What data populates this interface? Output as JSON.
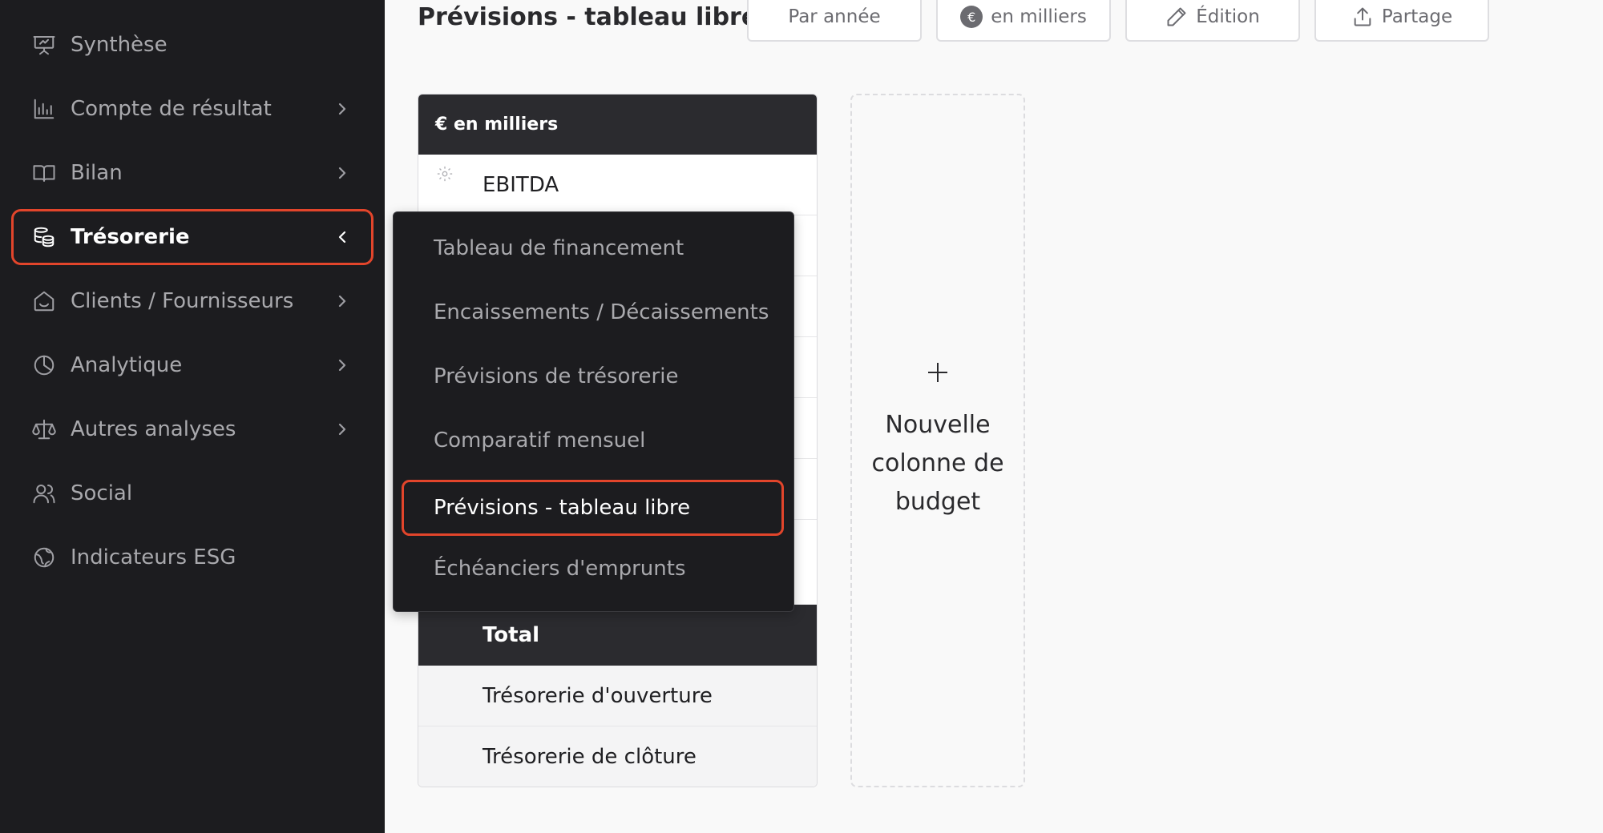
{
  "sidebar": {
    "items": [
      {
        "label": "Synthèse",
        "icon": "presentation-icon",
        "has_chevron": false,
        "active": false
      },
      {
        "label": "Compte de résultat",
        "icon": "bar-chart-icon",
        "has_chevron": true,
        "active": false
      },
      {
        "label": "Bilan",
        "icon": "book-icon",
        "has_chevron": true,
        "active": false
      },
      {
        "label": "Trésorerie",
        "icon": "coins-icon",
        "has_chevron": true,
        "active": true
      },
      {
        "label": "Clients / Fournisseurs",
        "icon": "home-icon",
        "has_chevron": true,
        "active": false
      },
      {
        "label": "Analytique",
        "icon": "pie-chart-icon",
        "has_chevron": true,
        "active": false
      },
      {
        "label": "Autres analyses",
        "icon": "scale-icon",
        "has_chevron": true,
        "active": false
      },
      {
        "label": "Social",
        "icon": "users-icon",
        "has_chevron": false,
        "active": false
      },
      {
        "label": "Indicateurs ESG",
        "icon": "globe-icon",
        "has_chevron": false,
        "active": false
      }
    ]
  },
  "header": {
    "title": "Prévisions - tableau libre",
    "buttons": [
      {
        "label": "Par année",
        "icon": ""
      },
      {
        "label": "en milliers",
        "icon": "euro-badge-icon",
        "badge": "€"
      },
      {
        "label": "Édition",
        "icon": "pencil-icon"
      },
      {
        "label": "Partage",
        "icon": "share-icon"
      }
    ]
  },
  "table": {
    "header": "€ en milliers",
    "rows": [
      "EBITDA",
      "",
      "",
      "",
      "",
      "",
      ""
    ],
    "total": "Total",
    "footer_rows": [
      "Trésorerie d'ouverture",
      "Trésorerie de clôture"
    ]
  },
  "new_column": {
    "label": "Nouvelle colonne de budget"
  },
  "dropdown": {
    "items": [
      {
        "label": "Tableau de financement",
        "active": false
      },
      {
        "label": "Encaissements / Décaissements",
        "active": false
      },
      {
        "label": "Prévisions de trésorerie",
        "active": false
      },
      {
        "label": "Comparatif mensuel",
        "active": false
      },
      {
        "label": "Prévisions - tableau libre",
        "active": true
      },
      {
        "label": "Échéanciers d'emprunts",
        "active": false
      }
    ]
  },
  "colors": {
    "sidebar_bg": "#1c1c1f",
    "highlight": "#e2452b",
    "table_header_bg": "#2b2b2f",
    "page_bg": "#f9f9f9"
  }
}
